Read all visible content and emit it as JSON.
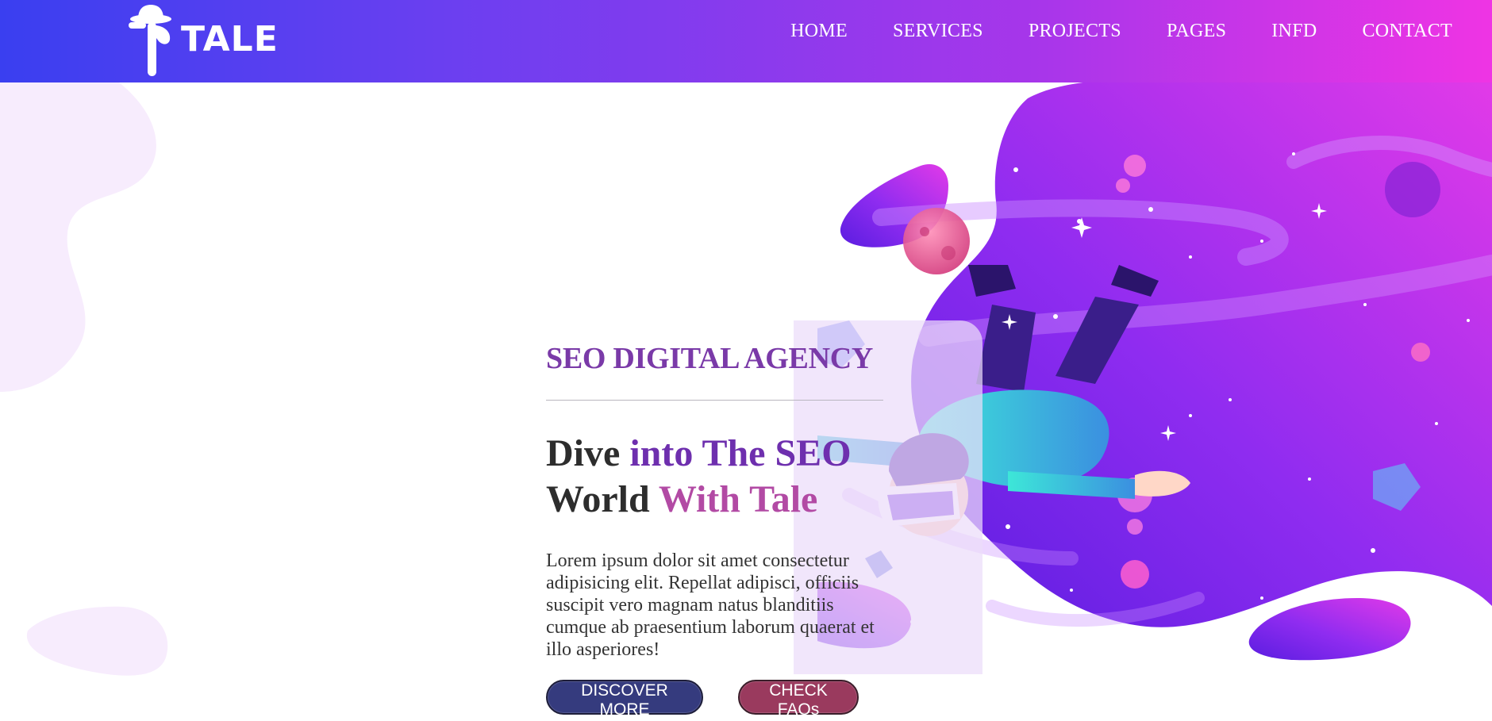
{
  "brand": {
    "name": "TALE",
    "logo_icon": "hat-figure-icon"
  },
  "nav": {
    "items": [
      {
        "label": "HOME"
      },
      {
        "label": "SERVICES"
      },
      {
        "label": "PROJECTS"
      },
      {
        "label": "PAGES"
      },
      {
        "label": "INFD"
      },
      {
        "label": "CONTACT"
      }
    ]
  },
  "hero": {
    "eyebrow": "SEO DIGITAL AGENCY",
    "headline": {
      "part1": "Dive ",
      "part2": "into The SEO",
      "part3": "World ",
      "part4": "With Tale"
    },
    "description": "Lorem ipsum dolor sit amet consectetur adipisicing elit. Repellat adipisci, officiis suscipit vero magnam natus blanditiis cumque ab praesentium laborum quaerat et illo asperiores!",
    "buttons": {
      "discover": "DISCOVER MORE",
      "faq": "CHECK FAQs"
    },
    "illustration": "vr-astronaut-floating-illustration"
  },
  "colors": {
    "nav_gradient_start": "#3a3ff0",
    "nav_gradient_end": "#ef34e4",
    "eyebrow": "#7a3aa8",
    "accent_purple": "#6e2fae",
    "accent_pink": "#b24aa4",
    "btn_discover": "#353b7e",
    "btn_faq": "#9a3a5e"
  }
}
